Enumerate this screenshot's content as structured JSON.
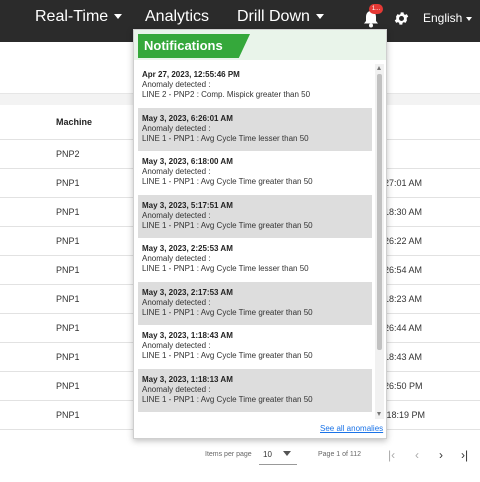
{
  "nav": {
    "realtime_label": "Real-Time",
    "analytics_label": "Analytics",
    "drilldown_label": "Drill Down",
    "language_label": "English",
    "badge_text": "1..."
  },
  "table": {
    "header_machine": "Machine",
    "rows": [
      {
        "machine": "PNP2",
        "time": ""
      },
      {
        "machine": "PNP1",
        "time": "27:01 AM"
      },
      {
        "machine": "PNP1",
        "time": "18:30 AM"
      },
      {
        "machine": "PNP1",
        "time": "26:22 AM"
      },
      {
        "machine": "PNP1",
        "time": "26:54 AM"
      },
      {
        "machine": "PNP1",
        "time": "18:23 AM"
      },
      {
        "machine": "PNP1",
        "time": "26:44 AM"
      },
      {
        "machine": "PNP1",
        "time": "18:43 AM"
      },
      {
        "machine": "PNP1",
        "time": "26:50 PM"
      },
      {
        "machine": "PNP1",
        "time": ":18:19 PM"
      }
    ]
  },
  "pagination": {
    "items_per_page_label": "Items per page",
    "items_per_page_value": "10",
    "page_info": "Page 1 of 112",
    "first": "|‹",
    "prev": "‹",
    "next": "›",
    "last": "›|"
  },
  "notifications": {
    "title": "Notifications",
    "see_all": "See all anomalies",
    "items": [
      {
        "timestamp": "Apr 27, 2023, 12:55:46 PM",
        "line1": "Anomaly detected :",
        "line2": "LINE 2 - PNP2 : Comp. Mispick greater than 50"
      },
      {
        "timestamp": "May 3, 2023, 6:26:01 AM",
        "line1": "Anomaly detected :",
        "line2": "LINE 1 - PNP1 : Avg Cycle Time lesser than 50"
      },
      {
        "timestamp": "May 3, 2023, 6:18:00 AM",
        "line1": "Anomaly detected :",
        "line2": "LINE 1 - PNP1 : Avg Cycle Time greater than 50"
      },
      {
        "timestamp": "May 3, 2023, 5:17:51 AM",
        "line1": "Anomaly detected :",
        "line2": "LINE 1 - PNP1 : Avg Cycle Time greater than 50"
      },
      {
        "timestamp": "May 3, 2023, 2:25:53 AM",
        "line1": "Anomaly detected :",
        "line2": "LINE 1 - PNP1 : Avg Cycle Time lesser than 50"
      },
      {
        "timestamp": "May 3, 2023, 2:17:53 AM",
        "line1": "Anomaly detected :",
        "line2": "LINE 1 - PNP1 : Avg Cycle Time greater than 50"
      },
      {
        "timestamp": "May 3, 2023, 1:18:43 AM",
        "line1": "Anomaly detected :",
        "line2": "LINE 1 - PNP1 : Avg Cycle Time greater than 50"
      },
      {
        "timestamp": "May 3, 2023, 1:18:13 AM",
        "line1": "Anomaly detected :",
        "line2": "LINE 1 - PNP1 : Avg Cycle Time greater than 50"
      }
    ]
  },
  "colors": {
    "topbar": "#2b2b2b",
    "notif_accent": "#35a83b",
    "badge": "#e53935",
    "link": "#1a73e8"
  },
  "icons": {
    "bell": "bell-icon",
    "gear": "gear-icon"
  }
}
